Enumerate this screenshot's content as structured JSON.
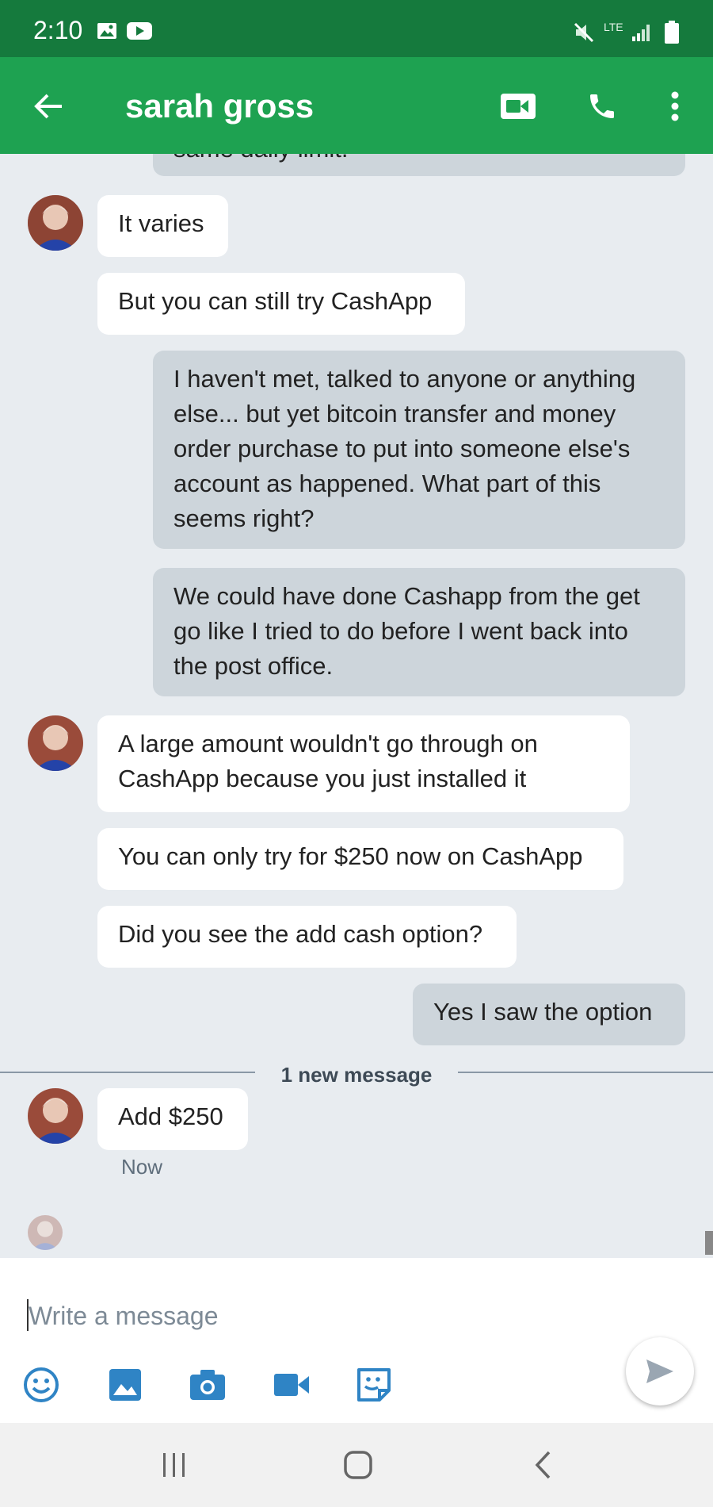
{
  "status": {
    "time": "2:10",
    "network": "LTE"
  },
  "header": {
    "contact_name": "sarah gross"
  },
  "messages": {
    "partial_top": "same daily limit.",
    "m1": "It varies",
    "m2": "But you can still try CashApp",
    "m3": "I haven't  met, talked to anyone or anything else... but yet bitcoin transfer and money order purchase to put into someone else's account as happened. What part of this seems right?",
    "m4": "We could have done Cashapp from the get go like I tried to do before I went back into the post office.",
    "m5": "A large amount wouldn't go through on CashApp because you just installed it",
    "m6": "You can only try for $250 now on CashApp",
    "m7": "Did you see the add cash option?",
    "m8": "Yes I saw the option",
    "new_divider": "1 new message",
    "m9": "Add $250",
    "m9_time": "Now"
  },
  "compose": {
    "placeholder": "Write a message"
  },
  "colors": {
    "status_bar": "#157a3d",
    "app_bar": "#1ea251",
    "outgoing_bubble": "#cdd5db",
    "incoming_bubble": "#ffffff",
    "chat_background": "#e8ecf0"
  }
}
